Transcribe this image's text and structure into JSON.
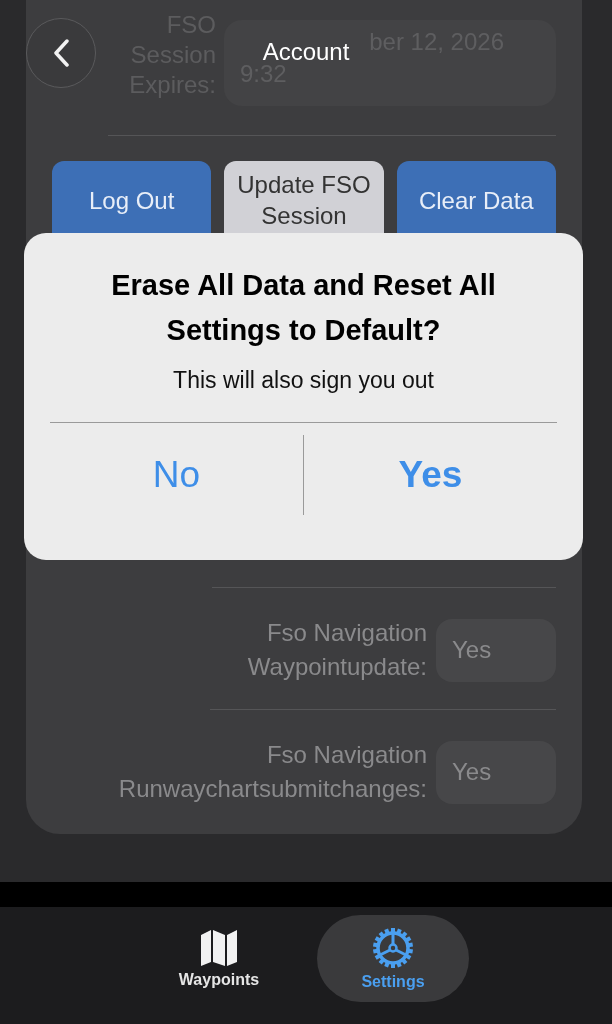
{
  "header": {
    "title": "Account"
  },
  "session": {
    "label": "FSO Session Expires:",
    "value_line_1": "ber 12, 2026",
    "value_line_2": "9:32"
  },
  "actions": [
    {
      "label": "Log Out",
      "kind": "primary"
    },
    {
      "label": "Update FSO Session",
      "kind": "secondary"
    },
    {
      "label": "Clear Data",
      "kind": "primary"
    }
  ],
  "settings": [
    {
      "label": "Fso Navigation Waypointupdate:",
      "value": "Yes"
    },
    {
      "label": "Fso Navigation Runwaychartsubmitchanges:",
      "value": "Yes"
    }
  ],
  "alert": {
    "title": "Erase All Data and Reset All Settings to Default?",
    "message": "This will also sign you out",
    "buttons": [
      {
        "label": "No",
        "kind": "cancel"
      },
      {
        "label": "Yes",
        "kind": "default"
      }
    ]
  },
  "tab_bar": {
    "tabs": [
      {
        "label": "Waypoints",
        "selected": false
      },
      {
        "label": "Settings",
        "selected": true
      }
    ]
  }
}
